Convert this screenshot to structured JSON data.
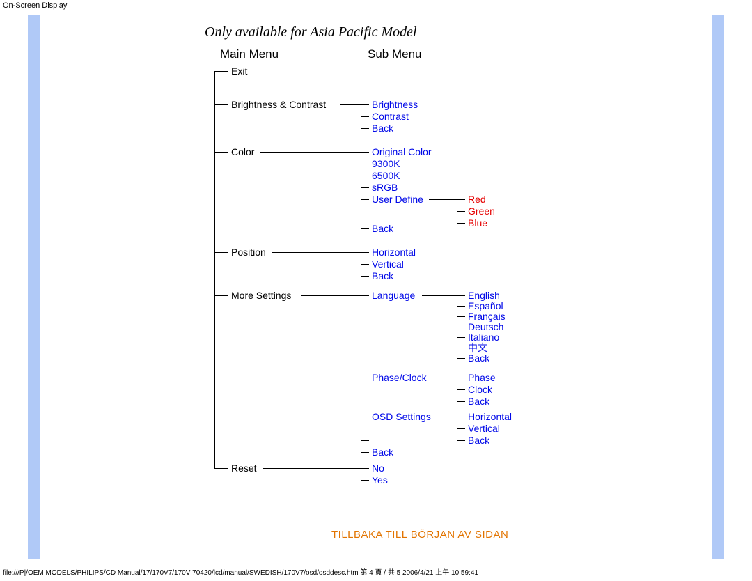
{
  "page_title": "On-Screen Display",
  "subtitle": "Only available for Asia Pacific Model",
  "headers": {
    "main": "Main Menu",
    "sub": "Sub Menu"
  },
  "main_menu": {
    "exit": "Exit",
    "brightness_contrast": "Brightness & Contrast",
    "color": "Color",
    "position": "Position",
    "more_settings": "More Settings",
    "reset": "Reset"
  },
  "sub": {
    "brightness": [
      "Brightness",
      "Contrast",
      "Back"
    ],
    "color": [
      "Original Color",
      "9300K",
      "6500K",
      "sRGB",
      "User Define",
      "Back"
    ],
    "user_define": [
      "Red",
      "Green",
      "Blue"
    ],
    "position": [
      "Horizontal",
      "Vertical",
      "Back"
    ],
    "more_settings": [
      "Language",
      "Phase/Clock",
      "OSD Settings",
      "Back"
    ],
    "language": [
      "English",
      "Español",
      "Français",
      "Deutsch",
      "Italiano",
      "中文",
      "Back"
    ],
    "phase_clock": [
      "Phase",
      "Clock",
      "Back"
    ],
    "osd_settings": [
      "Horizontal",
      "Vertical",
      "Back"
    ],
    "reset": [
      "No",
      "Yes"
    ]
  },
  "back_to_top": "TILLBAKA TILL BÖRJAN AV SIDAN",
  "footer": "file:///P|/OEM MODELS/PHILIPS/CD Manual/17/170V7/170V 70420/lcd/manual/SWEDISH/170V7/osd/osddesc.htm 第 4 頁 / 共 5 2006/4/21 上午 10:59:41"
}
